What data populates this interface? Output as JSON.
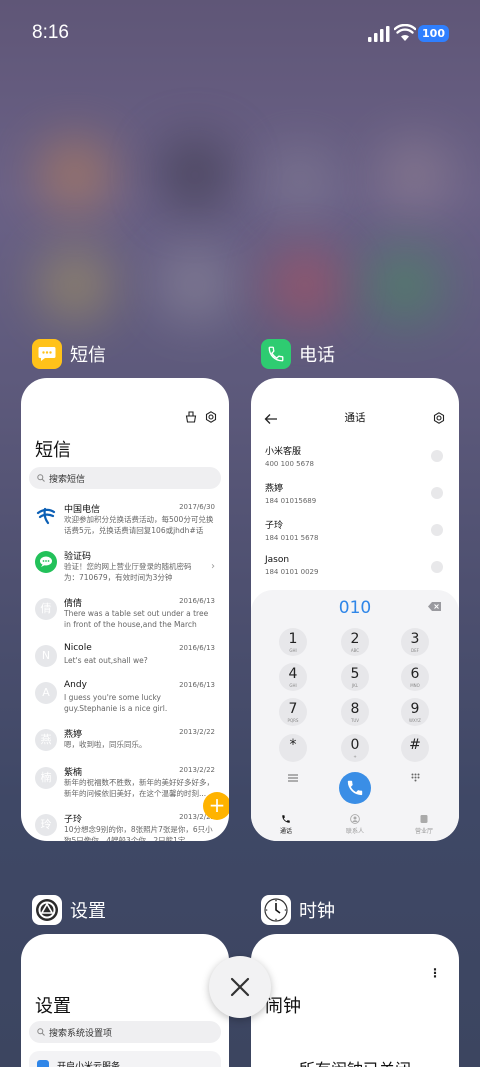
{
  "status_bar": {
    "time": "8:16",
    "battery": "100"
  },
  "apps": {
    "sms": {
      "label": "短信",
      "page_title": "短信",
      "search_placeholder": "搜索短信",
      "messages": [
        {
          "name": "中国电信",
          "date": "2017/6/30",
          "preview": "欢迎参加积分兑换话费活动，每500分可兑换话费5元，兑换话费请回复106或jhdh#话费..."
        },
        {
          "name": "验证码",
          "date": "",
          "preview": "验证！您的网上营业厅登录的随机密码为：710679，有效时间为3分钟"
        },
        {
          "name": "倩倩",
          "date": "2016/6/13",
          "preview": "There was a table set out under a tree in front of the house,and the March Hare an..."
        },
        {
          "name": "Nicole",
          "date": "2016/6/13",
          "preview": "Let's eat out,shall we?"
        },
        {
          "name": "Andy",
          "date": "2016/6/13",
          "preview": "I guess you're some lucky guy.Stephanie is a nice girl."
        },
        {
          "name": "燕婷",
          "date": "2013/2/22",
          "preview": "嗯，收到啦，同乐同乐。"
        },
        {
          "name": "紫楠",
          "date": "2013/2/22",
          "preview": "新年的祝福数不胜数，新年的美好好多好多，新年的问候依旧美好，在这个温馨的时刻..."
        },
        {
          "name": "子玲",
          "date": "2013/2/22",
          "preview": "10分想念9别的你，8张照片7张是你，6只小狗5只像你，4艘船3个你，2只熊1宝..."
        }
      ]
    },
    "phone": {
      "label": "电话",
      "page_title": "通话",
      "contacts": [
        {
          "name": "小米客服",
          "number": "400 100 5678"
        },
        {
          "name": "燕婷",
          "number": "184 01015689"
        },
        {
          "name": "子玲",
          "number": "184 0101 5678"
        },
        {
          "name": "Jason",
          "number": "184 0101 0029"
        }
      ],
      "dialed": "010",
      "keys": [
        {
          "d": "1",
          "l": "GHI"
        },
        {
          "d": "2",
          "l": "ABC"
        },
        {
          "d": "3",
          "l": "DEF"
        },
        {
          "d": "4",
          "l": "GHI"
        },
        {
          "d": "5",
          "l": "JKL"
        },
        {
          "d": "6",
          "l": "MNO"
        },
        {
          "d": "7",
          "l": "PQRS"
        },
        {
          "d": "8",
          "l": "TUV"
        },
        {
          "d": "9",
          "l": "WXYZ"
        },
        {
          "d": "*",
          "l": ""
        },
        {
          "d": "0",
          "l": "+"
        },
        {
          "d": "#",
          "l": ""
        }
      ],
      "tabs": [
        "通话",
        "联系人",
        "营业厅"
      ]
    },
    "settings": {
      "label": "设置",
      "page_title": "设置",
      "search_placeholder": "搜索系统设置项",
      "first_item": "开启小米云服务"
    },
    "clock": {
      "label": "时钟",
      "page_title": "闹钟",
      "empty_text": "所有闹钟已关闭"
    }
  },
  "colors": {
    "accent": "#2f86e8",
    "fab": "#ffb300",
    "sms_icon": "#ffc21a",
    "phone_icon": "#2ecc71"
  }
}
